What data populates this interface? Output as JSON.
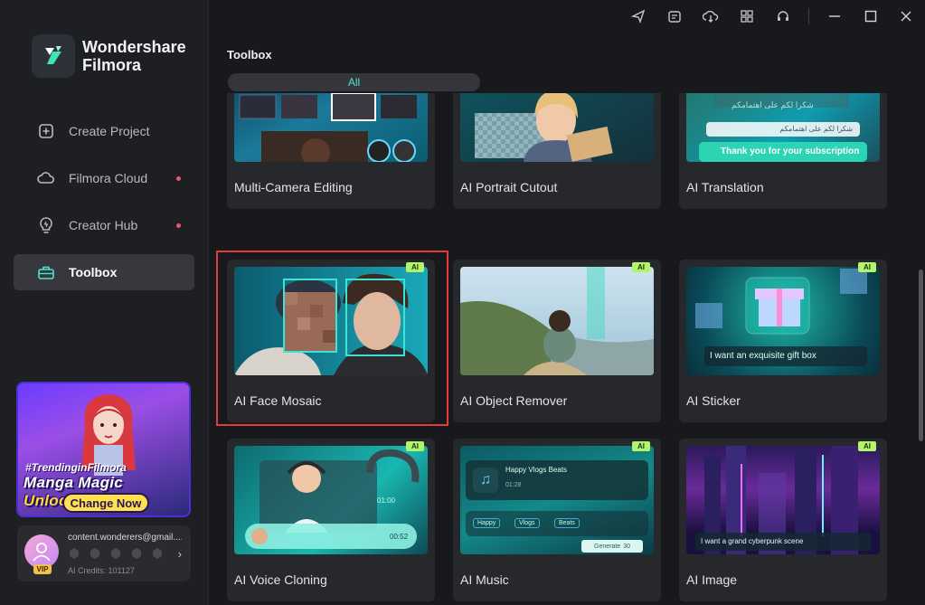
{
  "app": {
    "brand_line1": "Wondershare",
    "brand_line2": "Filmora"
  },
  "sidebar": {
    "items": [
      {
        "label": "Create Project",
        "icon": "plus-square-icon",
        "dot": false,
        "active": false
      },
      {
        "label": "Filmora Cloud",
        "icon": "cloud-icon",
        "dot": true,
        "active": false
      },
      {
        "label": "Creator Hub",
        "icon": "lightbulb-icon",
        "dot": true,
        "active": false
      },
      {
        "label": "Toolbox",
        "icon": "toolbox-icon",
        "dot": false,
        "active": true
      }
    ]
  },
  "promo": {
    "tag": "#TrendinginFilmora",
    "title_a": "Manga Magic ",
    "title_b": "Unlocked",
    "button": "Change Now"
  },
  "account": {
    "email": "content.wonderers@gmail....",
    "badge": "VIP",
    "credits": "AI Credits: 101127"
  },
  "topbar": {
    "icons": [
      "send-icon",
      "calendar-task-icon",
      "cloud-download-icon",
      "grid-icon",
      "headset-icon",
      "minimize-icon",
      "maximize-icon",
      "close-icon"
    ]
  },
  "main": {
    "section_title": "Toolbox",
    "filter_all": "All",
    "badge": "AI",
    "cards": [
      {
        "label": "Multi-Camera Editing",
        "ai": false
      },
      {
        "label": "AI Portrait Cutout",
        "ai": true
      },
      {
        "label": "AI Translation",
        "ai": true
      },
      {
        "label": "AI Face Mosaic",
        "ai": true
      },
      {
        "label": "AI Object Remover",
        "ai": true
      },
      {
        "label": "AI Sticker",
        "ai": true
      },
      {
        "label": "AI Voice Cloning",
        "ai": true
      },
      {
        "label": "AI Music",
        "ai": true
      },
      {
        "label": "AI Image",
        "ai": true
      }
    ],
    "thumb_text": {
      "translation_ar1": "شكرا لكم على اهتمامكم",
      "translation_ar2": "شكرا لكم على اهتمامكم",
      "translation_en": "Thank you for your subscription",
      "sticker_prompt": "I want an exquisite gift box",
      "voice_time1": "01:00",
      "voice_time2": "00:52",
      "music_title": "Happy Vlogs Beats",
      "music_time": "01:28",
      "music_tag1": "Happy",
      "music_tag2": "Vlogs",
      "music_tag3": "Beats",
      "music_generate": "Generate",
      "music_credits": "30",
      "image_prompt": "I want a grand cyberpunk scene"
    }
  }
}
